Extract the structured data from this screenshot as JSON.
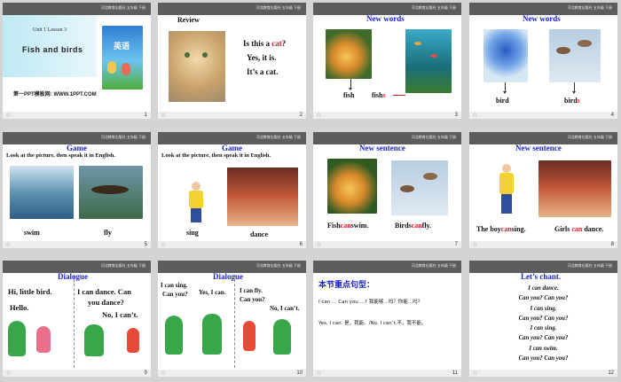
{
  "header_text": "河北教育出版社 五年级 下册",
  "footer_star": "☆",
  "slides": [
    {
      "num": "1",
      "book_line1": "Unit 1 Lesson 3",
      "book_line2": "Fish  and  birds",
      "book_cover_title": "英语",
      "watermark": "第一PPT模板网: WWW.1PPT.COM"
    },
    {
      "num": "2",
      "title": "Review",
      "line1a": "Is this a ",
      "line1b": "cat",
      "line1c": "?",
      "line2": "Yes, it is.",
      "line3": "It’s a cat."
    },
    {
      "num": "3",
      "title": "New words",
      "label1": "fish",
      "label2a": "fish",
      "label2b": "s"
    },
    {
      "num": "4",
      "title": "New words",
      "label1": "bird",
      "label2a": "bird",
      "label2b": "s"
    },
    {
      "num": "5",
      "title": "Game",
      "subtitle": "Look at the picture, then speak it in English.",
      "label1": "swim",
      "label2": "fly"
    },
    {
      "num": "6",
      "title": "Game",
      "subtitle": "Look at the picture, then speak it in English.",
      "label1": "sing",
      "label2": "dance"
    },
    {
      "num": "7",
      "title": "New sentence",
      "s1a": "Fish",
      "s1b": "can",
      "s1c": "swim.",
      "s2a": "Birds",
      "s2b": "can",
      "s2c": "fly."
    },
    {
      "num": "8",
      "title": "New sentence",
      "s1a": "The boy",
      "s1b": "can",
      "s1c": "sing.",
      "s2a": "Girls",
      "s2b": "can",
      "s2c": "dance."
    },
    {
      "num": "9",
      "title": "Dialogue",
      "left1": "Hi, little bird.",
      "left2": "Hello.",
      "right1": "I can dance. Can",
      "right2": "you dance?",
      "right3": "No, I can’t."
    },
    {
      "num": "10",
      "title": "Dialogue",
      "a1": "I can sing.",
      "a2": "Can you?",
      "a3": "Yes, I can.",
      "b1": "I can fly.",
      "b2": "Can you?",
      "b3": "No, I can’t."
    },
    {
      "num": "11",
      "title": "本节重点句型：",
      "line1": "I can … Can you …?  我能够…吗？你能…吗？",
      "line2": "Yes, I can. 是，我能。/No, I can’t.不，我不能。"
    },
    {
      "num": "12",
      "title": "Let’s chant.",
      "lines": [
        "I can dance.",
        "Can you? Can you?",
        "I can sing.",
        "Can you? Can you?",
        "I can sing.",
        "Can you? Can you?",
        "I can swim.",
        "Can you? Can you?"
      ]
    }
  ]
}
